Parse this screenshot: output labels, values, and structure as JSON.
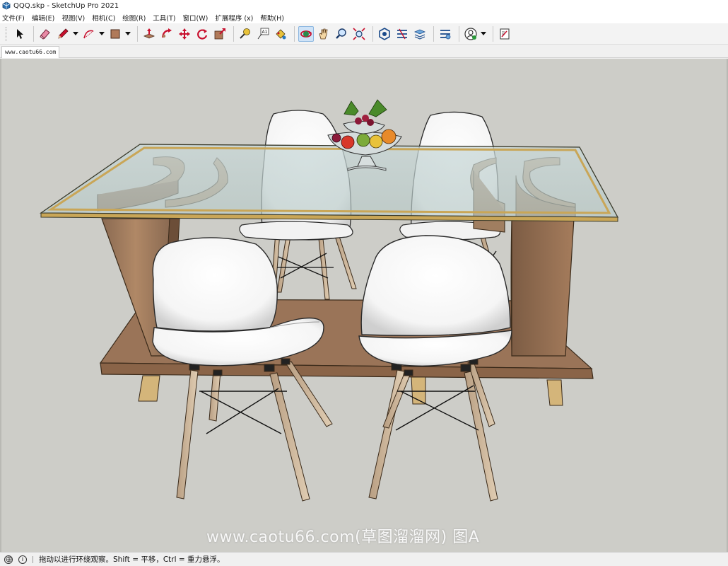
{
  "window": {
    "title": "QQQ.skp - SketchUp Pro 2021"
  },
  "menu": [
    {
      "label": "文件(F)"
    },
    {
      "label": "编辑(E)"
    },
    {
      "label": "视图(V)"
    },
    {
      "label": "相机(C)"
    },
    {
      "label": "绘图(R)"
    },
    {
      "label": "工具(T)"
    },
    {
      "label": "窗口(W)"
    },
    {
      "label": "扩展程序 (x)"
    },
    {
      "label": "帮助(H)"
    }
  ],
  "toolbar": {
    "tools": [
      "select-icon",
      "eraser-icon",
      "pencil-icon",
      "arc-icon",
      "rectangle-icon",
      "push-pull-icon",
      "follow-me-icon",
      "move-icon",
      "rotate-icon",
      "scale-icon",
      "tape-measure-icon",
      "text-icon",
      "paint-bucket-icon",
      "orbit-icon",
      "pan-icon",
      "zoom-icon",
      "zoom-extents-icon",
      "3d-warehouse-icon",
      "extension-warehouse-icon",
      "layout-icon",
      "styles-icon",
      "account-icon",
      "send-to-layout-icon"
    ],
    "active_tool": "orbit-icon",
    "label_text_tool": "A1"
  },
  "scene_tab": {
    "label": "www.caotu66.com"
  },
  "viewport": {
    "background_color": "#cdcdc8",
    "watermark": "www.caotu66.com(草图溜溜网) 图A"
  },
  "status": {
    "icon_info": "i",
    "message": "拖动以进行环绕观察。Shift = 平移，Ctrl = 重力悬浮。"
  }
}
